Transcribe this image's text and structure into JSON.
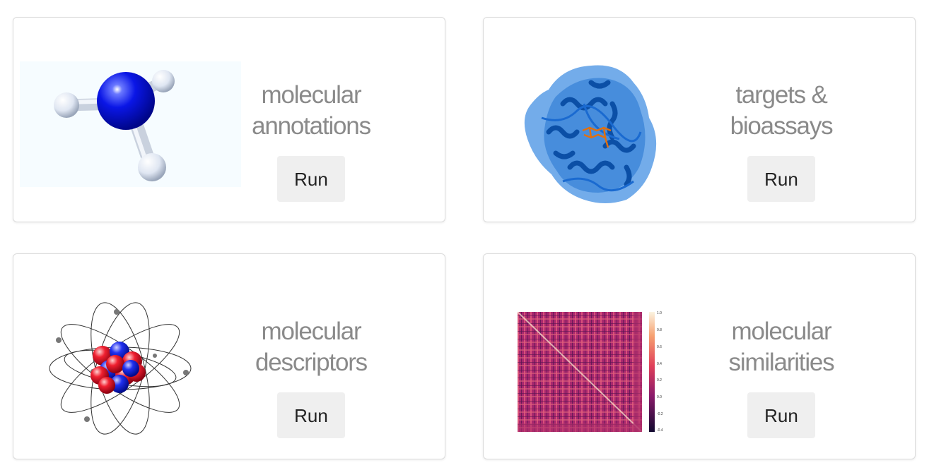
{
  "cards": [
    {
      "id": "molecular-annotations",
      "title_line1": "molecular",
      "title_line2": "annotations",
      "button_label": "Run",
      "image": "ammonia-molecule-model"
    },
    {
      "id": "targets-bioassays",
      "title_line1": "targets &",
      "title_line2": "bioassays",
      "button_label": "Run",
      "image": "protein-structure-ribbon"
    },
    {
      "id": "molecular-descriptors",
      "title_line1": "molecular",
      "title_line2": "descriptors",
      "button_label": "Run",
      "image": "atom-orbit-model"
    },
    {
      "id": "molecular-similarities",
      "title_line1": "molecular",
      "title_line2": "similarities",
      "button_label": "Run",
      "image": "similarity-heatmap"
    }
  ],
  "heatmap_colorbar": {
    "tick_labels": [
      "1.0",
      "0.8",
      "0.6",
      "0.4",
      "0.2",
      "0.0",
      "-0.2",
      "-0.4"
    ]
  },
  "colors": {
    "title_text": "#8a8a8a",
    "button_bg": "#efefef",
    "nitrogen": "#0a16e6",
    "hydrogen": "#e8eef8",
    "protein_blue": "#1560c0",
    "ligand_orange": "#e07010",
    "heatmap_base": "#a8286e"
  }
}
